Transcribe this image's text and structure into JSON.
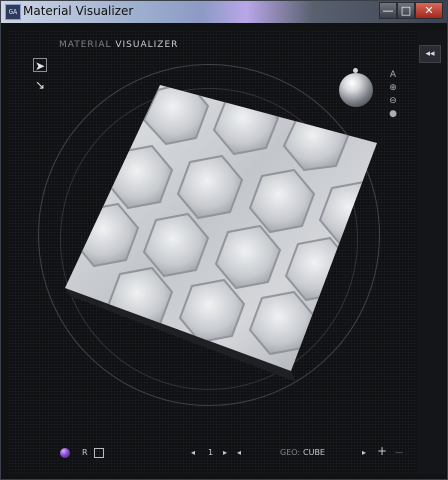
{
  "window": {
    "title": "Material Visualizer",
    "app_icon_text": "GA",
    "controls": {
      "minimize": "—",
      "maximize": "□",
      "close": "✕"
    }
  },
  "viewport": {
    "title_prefix": "MATERIAL",
    "title_main": "VISUALIZER",
    "collapse_label": "◂◂"
  },
  "tools": {
    "select": "➤",
    "transform": "↘"
  },
  "side_icons": [
    "A",
    "⊕",
    "⊖",
    "●"
  ],
  "bottom_bar": {
    "render_label": "R",
    "page_prev": "◂",
    "page_number": "1",
    "page_next": "▸",
    "page_last": "◂",
    "geo_label": "GEO:",
    "geo_value": "CUBE",
    "geo_next": "▸",
    "add": "+",
    "remove": "—"
  },
  "colors": {
    "viewport_bg": "#0f1012",
    "surface": "#c9cbd0",
    "title_gradient_accent": "#b9a6e8"
  }
}
